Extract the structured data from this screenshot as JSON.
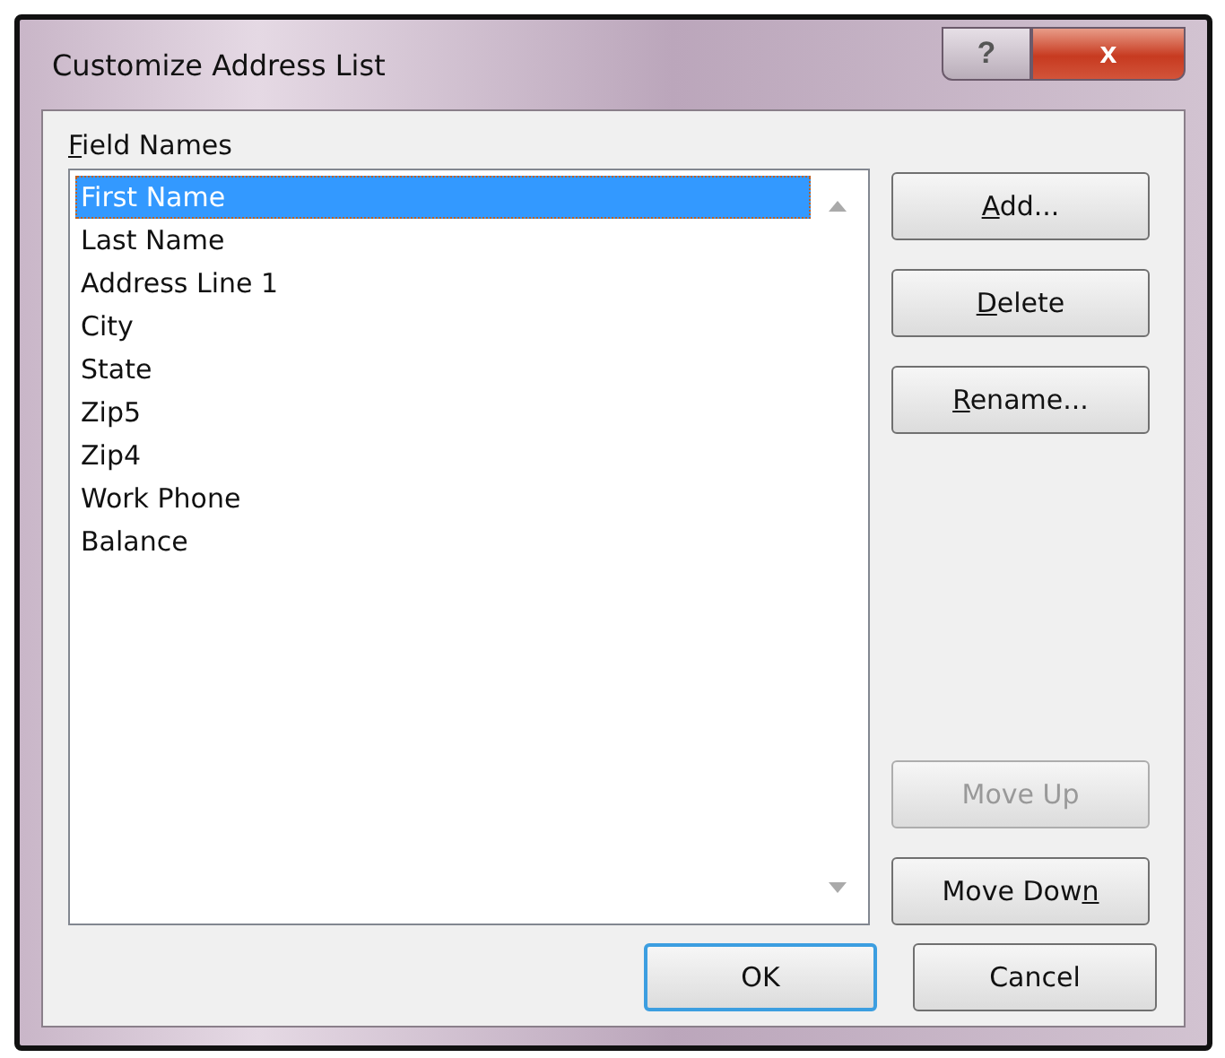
{
  "window": {
    "title": "Customize Address List",
    "controls": [
      "?",
      "x"
    ]
  },
  "field_names": {
    "label": {
      "key": "F",
      "post": "ield Names"
    },
    "items": [
      {
        "label": "First Name",
        "selected": true
      },
      {
        "label": "Last Name",
        "selected": false
      },
      {
        "label": "Address Line 1",
        "selected": false
      },
      {
        "label": "City",
        "selected": false
      },
      {
        "label": "State",
        "selected": false
      },
      {
        "label": "Zip5",
        "selected": false
      },
      {
        "label": "Zip4",
        "selected": false
      },
      {
        "label": "Work Phone",
        "selected": false
      },
      {
        "label": "Balance",
        "selected": false
      }
    ]
  },
  "side_buttons": [
    {
      "label": {
        "key": "A",
        "post": "dd..."
      },
      "disabled": false
    },
    {
      "label": {
        "key": "D",
        "post": "elete"
      },
      "disabled": false
    },
    {
      "label": {
        "key": "R",
        "post": "ename..."
      },
      "disabled": false
    },
    {
      "label": {
        "pre": "Move Up"
      },
      "disabled": true
    },
    {
      "label": {
        "pre": "Move Dow",
        "key": "n"
      },
      "disabled": false
    }
  ],
  "footer_buttons": [
    {
      "label": "OK",
      "default": true
    },
    {
      "label": "Cancel",
      "default": false
    }
  ]
}
